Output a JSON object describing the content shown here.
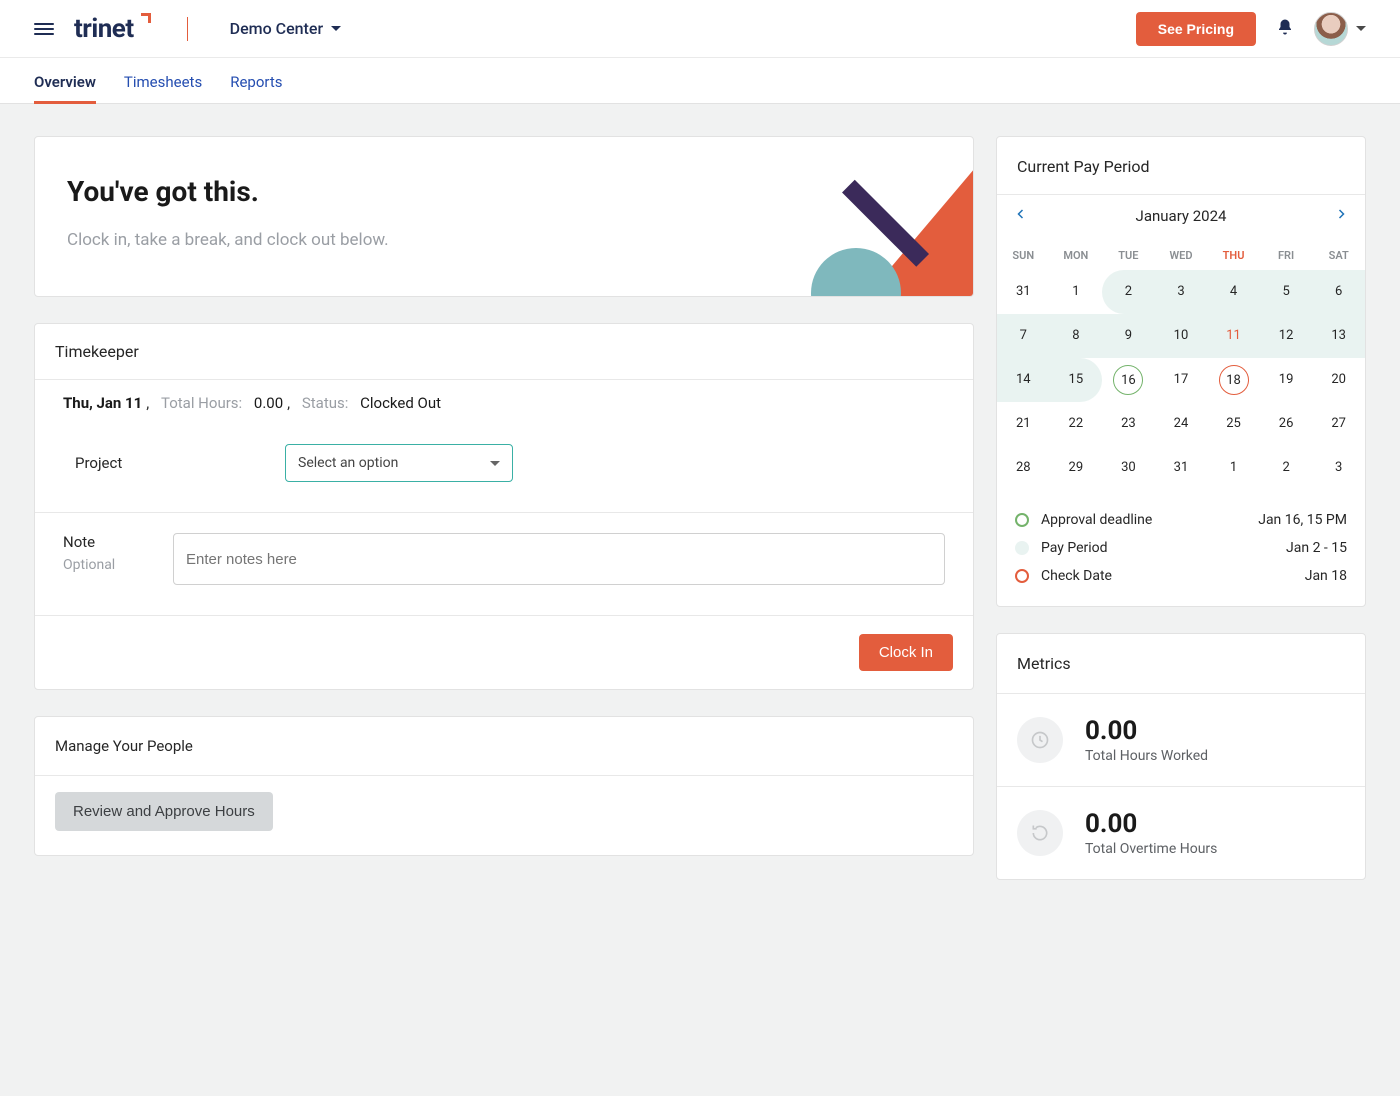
{
  "header": {
    "logo_text": "trinet",
    "workspace": "Demo Center",
    "pricing_btn": "See Pricing"
  },
  "tabs": {
    "overview": "Overview",
    "timesheets": "Timesheets",
    "reports": "Reports"
  },
  "hero": {
    "title": "You've got this.",
    "subtitle": "Clock in, take a break, and clock out below."
  },
  "timekeeper": {
    "title": "Timekeeper",
    "date": "Thu, Jan 11",
    "hours_label": "Total Hours:",
    "hours_value": "0.00",
    "status_label": "Status:",
    "status_value": "Clocked Out",
    "project_label": "Project",
    "project_placeholder": "Select an option",
    "note_label": "Note",
    "note_optional": "Optional",
    "note_placeholder": "Enter notes here",
    "clockin_btn": "Clock In"
  },
  "manage": {
    "title": "Manage Your People",
    "review_btn": "Review and Approve Hours"
  },
  "calendar": {
    "title": "Current Pay Period",
    "month": "January 2024",
    "dow": [
      "SUN",
      "MON",
      "TUE",
      "WED",
      "THU",
      "FRI",
      "SAT"
    ],
    "weeks": [
      [
        {
          "n": "31",
          "muted": true
        },
        {
          "n": "1"
        },
        {
          "n": "2",
          "pp": true,
          "start": true
        },
        {
          "n": "3",
          "pp": true
        },
        {
          "n": "4",
          "pp": true
        },
        {
          "n": "5",
          "pp": true
        },
        {
          "n": "6",
          "pp": true
        }
      ],
      [
        {
          "n": "7",
          "pp": true
        },
        {
          "n": "8",
          "pp": true
        },
        {
          "n": "9",
          "pp": true
        },
        {
          "n": "10",
          "pp": true
        },
        {
          "n": "11",
          "pp": true,
          "today": true
        },
        {
          "n": "12",
          "pp": true
        },
        {
          "n": "13",
          "pp": true
        }
      ],
      [
        {
          "n": "14",
          "pp": true
        },
        {
          "n": "15",
          "pp": true,
          "end": true
        },
        {
          "n": "16",
          "green": true
        },
        {
          "n": "17"
        },
        {
          "n": "18",
          "red": true
        },
        {
          "n": "19"
        },
        {
          "n": "20"
        }
      ],
      [
        {
          "n": "21"
        },
        {
          "n": "22"
        },
        {
          "n": "23"
        },
        {
          "n": "24"
        },
        {
          "n": "25"
        },
        {
          "n": "26"
        },
        {
          "n": "27"
        }
      ],
      [
        {
          "n": "28"
        },
        {
          "n": "29"
        },
        {
          "n": "30"
        },
        {
          "n": "31"
        },
        {
          "n": "1",
          "muted": true
        },
        {
          "n": "2",
          "muted": true
        },
        {
          "n": "3",
          "muted": true
        }
      ]
    ],
    "legend": {
      "approval_label": "Approval deadline",
      "approval_value": "Jan 16, 15 PM",
      "payperiod_label": "Pay Period",
      "payperiod_value": "Jan 2 - 15",
      "check_label": "Check Date",
      "check_value": "Jan 18"
    }
  },
  "metrics": {
    "title": "Metrics",
    "worked_value": "0.00",
    "worked_label": "Total Hours Worked",
    "ot_value": "0.00",
    "ot_label": "Total Overtime Hours"
  }
}
